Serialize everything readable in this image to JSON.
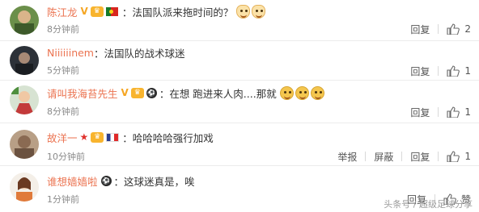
{
  "comments": [
    {
      "name": "陈江龙",
      "text": "法国队派来拖时间的？",
      "time": "8分钟前",
      "reply": "回复",
      "likes": "2",
      "badges": [
        "verified-v",
        "vip",
        "flag-portugal"
      ],
      "emoji": [
        "cat-laugh",
        "cat-laugh"
      ]
    },
    {
      "name": "Niiiiiinem",
      "text": "法国队的战术球迷",
      "time": "5分钟前",
      "reply": "回复",
      "likes": "1",
      "badges": [],
      "emoji": []
    },
    {
      "name": "请叫我海苔先生",
      "text": "在想 跑进来人肉....那就",
      "time": "8分钟前",
      "reply": "回复",
      "likes": "1",
      "badges": [
        "verified-v",
        "vip",
        "football"
      ],
      "emoji": [
        "laugh-cry",
        "laugh-cry",
        "laugh-cry"
      ]
    },
    {
      "name": "故洋一",
      "text": "哈哈哈哈强行加戏",
      "time": "10分钟前",
      "report": "举报",
      "block": "屏蔽",
      "reply": "回复",
      "likes": "1",
      "badges": [
        "star",
        "vip",
        "flag-france"
      ],
      "emoji": []
    },
    {
      "name": "谁想嫱嫱啦",
      "text": "这球迷真是，唉",
      "time": "1分钟前",
      "reply": "回复",
      "likes": "赞",
      "badges": [
        "football"
      ],
      "emoji": []
    }
  ],
  "watermark": "头条号 / 超级足球分享",
  "colors": {
    "name": "#eb7350",
    "text": "#333333",
    "time": "#8a8a8a",
    "separator": "#ececec"
  }
}
